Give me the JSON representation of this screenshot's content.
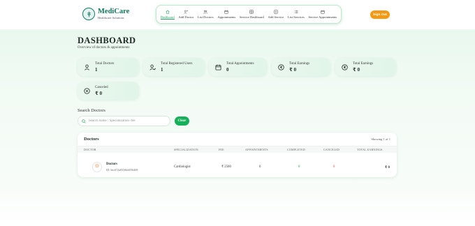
{
  "header": {
    "brand": "MediCare",
    "brand_sub": "Healthcare Solutions",
    "nav": [
      {
        "label": "Dashboard",
        "icon": "home-icon",
        "active": true
      },
      {
        "label": "Add Doctor",
        "icon": "user-plus-icon",
        "active": false
      },
      {
        "label": "List Doctors",
        "icon": "users-icon",
        "active": false
      },
      {
        "label": "Appointments",
        "icon": "calendar-icon",
        "active": false
      },
      {
        "label": "Service Dashboard",
        "icon": "grid-icon",
        "active": false
      },
      {
        "label": "Add Service",
        "icon": "plus-square-icon",
        "active": false
      },
      {
        "label": "List Services",
        "icon": "list-icon",
        "active": false
      },
      {
        "label": "Service Appointments",
        "icon": "calendar-icon",
        "active": false
      }
    ],
    "signup_label": "Sign Out"
  },
  "page": {
    "title": "DASHBOARD",
    "subtitle": "Overview of doctors & appointments"
  },
  "stats": [
    {
      "label": "Total Doctors",
      "value": "1",
      "icon": "user-icon"
    },
    {
      "label": "Total Registered Users",
      "value": "1",
      "icon": "user-check-icon"
    },
    {
      "label": "Total Appointments",
      "value": "0",
      "icon": "calendar-icon"
    },
    {
      "label": "Total Earnings",
      "value": "₹ 0",
      "icon": "rupee-circle-icon"
    },
    {
      "label": "Total Earnings",
      "value": "₹ 0",
      "icon": "rupee-circle-icon"
    },
    {
      "label": "Canceled",
      "value": "₹ 0",
      "icon": "x-circle-icon"
    }
  ],
  "search": {
    "label": "Search Doctors",
    "placeholder": "Search name / Specialization /fee",
    "value": "",
    "clear_label": "Clear"
  },
  "table": {
    "title": "Doctors",
    "count": "Showing 1 of 1",
    "columns": [
      "DOCTOR",
      "SPECIALIZATION",
      "FEE",
      "APPOINTMENTS",
      "COMPLETED",
      "CANCELED",
      "TOTAL EARNINGS"
    ],
    "rows": [
      {
        "name": "Doctors",
        "id": "ID: 6ec672a835f6fef056469",
        "specialization": "Cardiologist",
        "fee": "₹ 2500",
        "appointments": "0",
        "completed": "0",
        "canceled": "0",
        "earnings": "₹ 0"
      }
    ]
  },
  "colors": {
    "brand": "#0f7a5a",
    "accent_green": "#17b05a",
    "signup_orange": "#f39a12",
    "canceled_red": "#e0464a"
  }
}
